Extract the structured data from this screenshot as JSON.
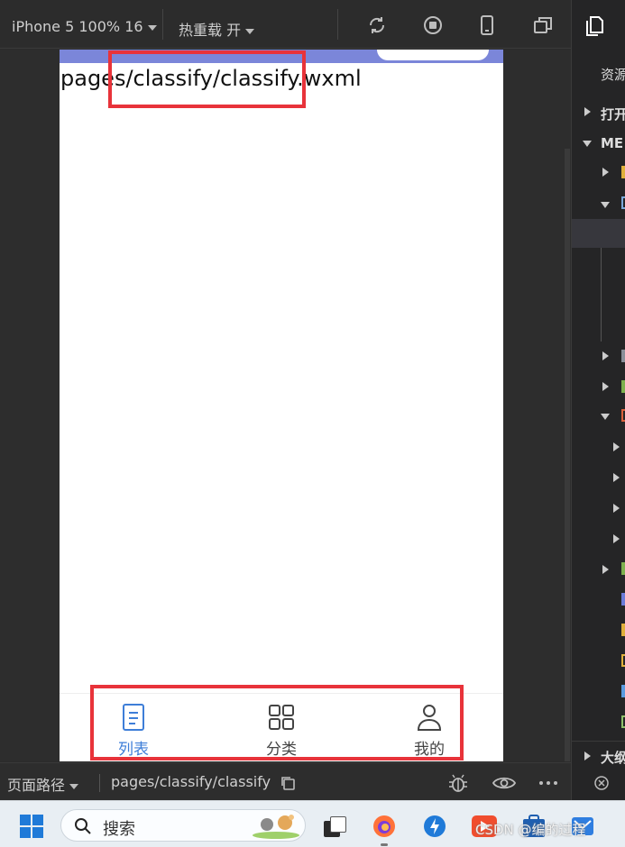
{
  "toolbar": {
    "device_label": "iPhone 5 100% 16",
    "hot_reload_label": "热重载 开"
  },
  "phone": {
    "page_text": "pages/classify/classify.wxml",
    "tabs": [
      {
        "label": "列表",
        "icon": "list-icon",
        "active": true
      },
      {
        "label": "分类",
        "icon": "grid-icon",
        "active": false
      },
      {
        "label": "我的",
        "icon": "user-icon",
        "active": false
      }
    ],
    "accent_color": "#3e7ed8",
    "navbar_color": "#7b86d9",
    "highlight_color": "#e8333a"
  },
  "pathbar": {
    "label": "页面路径",
    "path": "pages/classify/classify"
  },
  "side": {
    "resource_label": "资源",
    "open_label": "打开",
    "project_label": "ME",
    "outline_label": "大纲"
  },
  "taskbar": {
    "search_label": "搜索",
    "watermark": "CSDN @编的过程"
  }
}
